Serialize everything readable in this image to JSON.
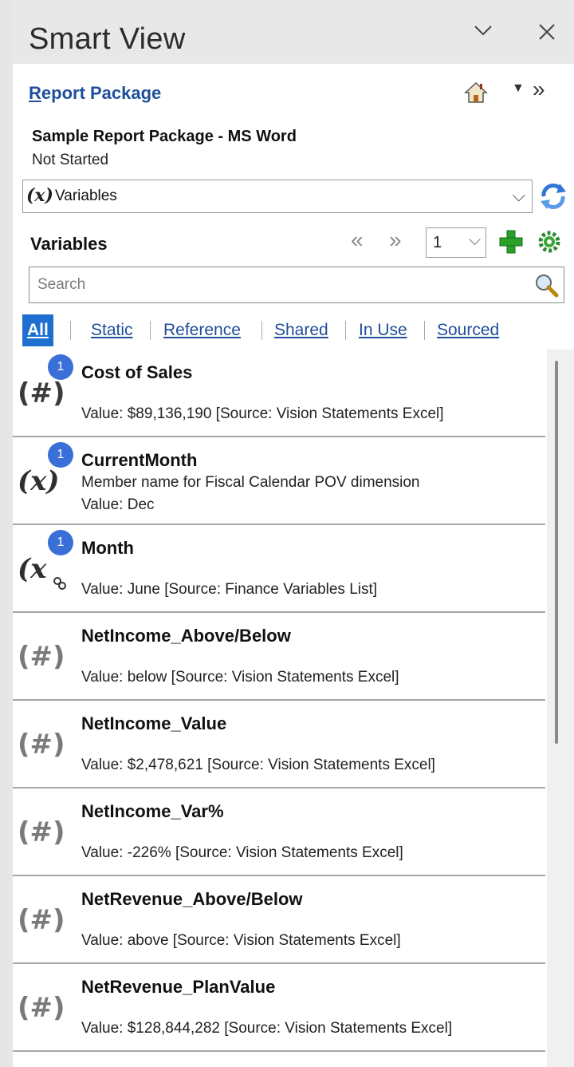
{
  "window": {
    "title": "Smart View"
  },
  "header": {
    "report_package_first": "R",
    "report_package_rest": "eport Package",
    "package_name": "Sample Report Package - MS Word",
    "status": "Not Started"
  },
  "view_select": {
    "icon_text": "(x)",
    "value": "Variables"
  },
  "variables_header": {
    "title": "Variables",
    "page_value": "1"
  },
  "search": {
    "placeholder": "Search"
  },
  "filters": [
    {
      "label": "All",
      "active": true
    },
    {
      "label": "Static",
      "active": false
    },
    {
      "label": "Reference",
      "active": false
    },
    {
      "label": "Shared",
      "active": false
    },
    {
      "label": "In Use",
      "active": false
    },
    {
      "label": "Sourced",
      "active": false
    }
  ],
  "items": [
    {
      "icon": "hash-icon",
      "badge": "1",
      "name": "Cost of Sales",
      "desc": "",
      "value": "Value:  $89,136,190  [Source: Vision Statements Excel]"
    },
    {
      "icon": "x-variable-icon",
      "badge": "1",
      "name": "CurrentMonth",
      "desc": "Member name for Fiscal Calendar POV dimension",
      "value": "Value: Dec"
    },
    {
      "icon": "x-variable-linked-icon",
      "badge": "1",
      "name": "Month",
      "desc": "",
      "value": "Value: June [Source: Finance Variables List]"
    },
    {
      "icon": "hash-icon",
      "badge": "",
      "name": "NetIncome_Above/Below",
      "desc": "",
      "value": "Value: below [Source: Vision Statements Excel]"
    },
    {
      "icon": "hash-icon",
      "badge": "",
      "name": "NetIncome_Value",
      "desc": "",
      "value": "Value:  $2,478,621  [Source: Vision Statements Excel]"
    },
    {
      "icon": "hash-icon",
      "badge": "",
      "name": "NetIncome_Var%",
      "desc": "",
      "value": "Value: -226% [Source: Vision Statements Excel]"
    },
    {
      "icon": "hash-icon",
      "badge": "",
      "name": "NetRevenue_Above/Below",
      "desc": "",
      "value": "Value: above [Source: Vision Statements Excel]"
    },
    {
      "icon": "hash-icon",
      "badge": "",
      "name": "NetRevenue_PlanValue",
      "desc": "",
      "value": "Value:  $128,844,282  [Source: Vision Statements Excel]"
    }
  ],
  "colors": {
    "accent": "#1f6fd1",
    "link": "#1f4e9a",
    "badge": "#3a6fd8",
    "add_green": "#2aa12a"
  }
}
